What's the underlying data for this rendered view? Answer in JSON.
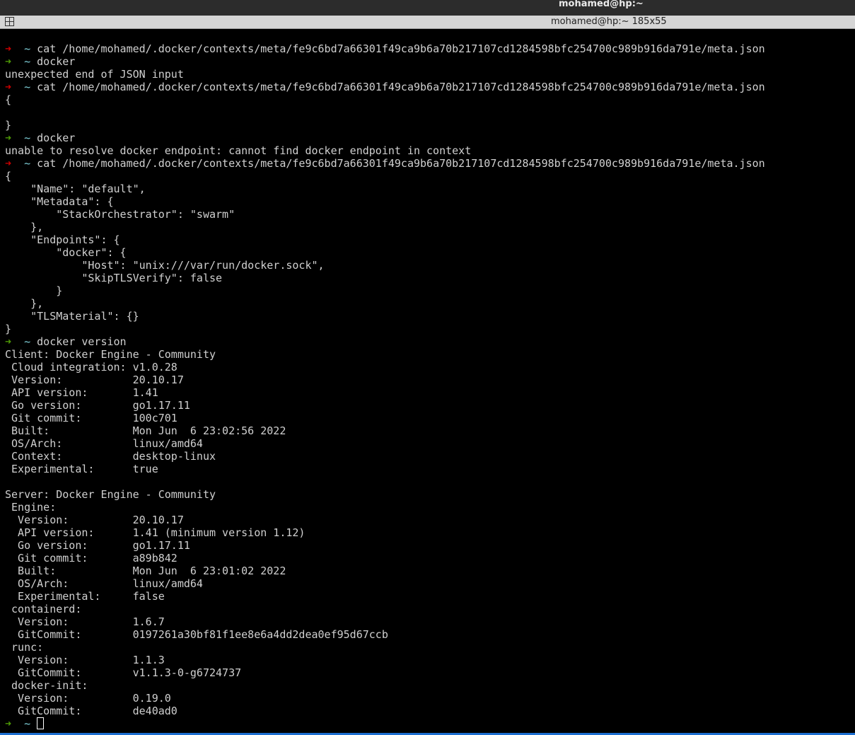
{
  "window": {
    "title": "mohamed@hp:~",
    "tab_title": "mohamed@hp:~ 185x55"
  },
  "colors": {
    "prompt_error": "#cc0000",
    "prompt_ok": "#4e9a06",
    "cwd": "#7ecfd8",
    "text": "#d0d0d0"
  },
  "prompt": {
    "arrow": "➜",
    "cwd": "~"
  },
  "lines": [
    {
      "p": "red",
      "text": "cat /home/mohamed/.docker/contexts/meta/fe9c6bd7a66301f49ca9b6a70b217107cd1284598bfc254700c989b916da791e/meta.json"
    },
    {
      "p": "green",
      "text": "docker"
    },
    {
      "text": "unexpected end of JSON input"
    },
    {
      "p": "red",
      "text": "cat /home/mohamed/.docker/contexts/meta/fe9c6bd7a66301f49ca9b6a70b217107cd1284598bfc254700c989b916da791e/meta.json"
    },
    {
      "text": "{"
    },
    {
      "text": ""
    },
    {
      "text": "}"
    },
    {
      "p": "green",
      "text": "docker"
    },
    {
      "text": "unable to resolve docker endpoint: cannot find docker endpoint in context"
    },
    {
      "p": "red",
      "text": "cat /home/mohamed/.docker/contexts/meta/fe9c6bd7a66301f49ca9b6a70b217107cd1284598bfc254700c989b916da791e/meta.json"
    },
    {
      "text": "{"
    },
    {
      "text": "    \"Name\": \"default\","
    },
    {
      "text": "    \"Metadata\": {"
    },
    {
      "text": "        \"StackOrchestrator\": \"swarm\""
    },
    {
      "text": "    },"
    },
    {
      "text": "    \"Endpoints\": {"
    },
    {
      "text": "        \"docker\": {"
    },
    {
      "text": "            \"Host\": \"unix:///var/run/docker.sock\","
    },
    {
      "text": "            \"SkipTLSVerify\": false"
    },
    {
      "text": "        }"
    },
    {
      "text": "    },"
    },
    {
      "text": "    \"TLSMaterial\": {}"
    },
    {
      "text": "}"
    },
    {
      "p": "green",
      "text": "docker version"
    },
    {
      "text": "Client: Docker Engine - Community"
    },
    {
      "text": " Cloud integration: v1.0.28"
    },
    {
      "text": " Version:           20.10.17"
    },
    {
      "text": " API version:       1.41"
    },
    {
      "text": " Go version:        go1.17.11"
    },
    {
      "text": " Git commit:        100c701"
    },
    {
      "text": " Built:             Mon Jun  6 23:02:56 2022"
    },
    {
      "text": " OS/Arch:           linux/amd64"
    },
    {
      "text": " Context:           desktop-linux"
    },
    {
      "text": " Experimental:      true"
    },
    {
      "text": ""
    },
    {
      "text": "Server: Docker Engine - Community"
    },
    {
      "text": " Engine:"
    },
    {
      "text": "  Version:          20.10.17"
    },
    {
      "text": "  API version:      1.41 (minimum version 1.12)"
    },
    {
      "text": "  Go version:       go1.17.11"
    },
    {
      "text": "  Git commit:       a89b842"
    },
    {
      "text": "  Built:            Mon Jun  6 23:01:02 2022"
    },
    {
      "text": "  OS/Arch:          linux/amd64"
    },
    {
      "text": "  Experimental:     false"
    },
    {
      "text": " containerd:"
    },
    {
      "text": "  Version:          1.6.7"
    },
    {
      "text": "  GitCommit:        0197261a30bf81f1ee8e6a4dd2dea0ef95d67ccb"
    },
    {
      "text": " runc:"
    },
    {
      "text": "  Version:          1.1.3"
    },
    {
      "text": "  GitCommit:        v1.1.3-0-g6724737"
    },
    {
      "text": " docker-init:"
    },
    {
      "text": "  Version:          0.19.0"
    },
    {
      "text": "  GitCommit:        de40ad0"
    },
    {
      "p": "green",
      "text": "",
      "cursor": true
    }
  ]
}
